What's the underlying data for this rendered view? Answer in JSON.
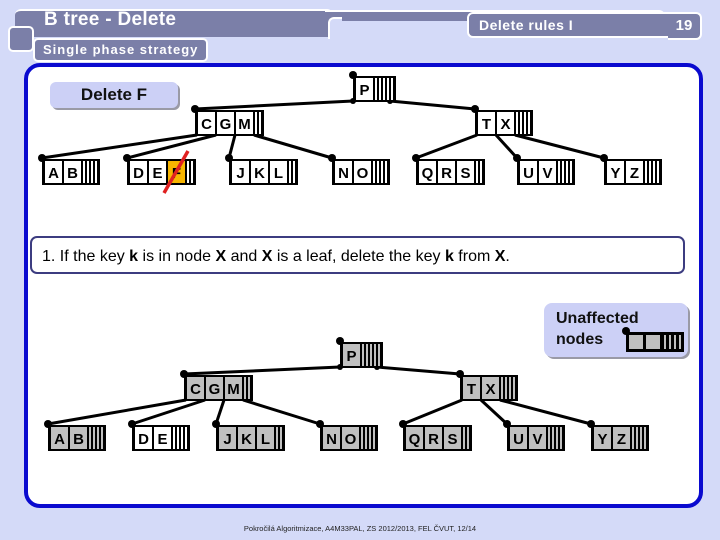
{
  "header": {
    "title": "B tree - Delete",
    "subtitle": "Single phase strategy",
    "section": "Delete rules I",
    "page_number": "19"
  },
  "operation_label": "Delete F",
  "rule": {
    "prefix": "1. If the key ",
    "k1": "k",
    "mid1": " is in node ",
    "x1": "X",
    "mid2": " and ",
    "x2": "X",
    "mid3": " is a leaf, delete the key ",
    "k2": "k",
    "mid4": " from ",
    "x3": "X",
    "suffix": "."
  },
  "legend": {
    "line1": "Unaffected",
    "line2": "nodes"
  },
  "colors": {
    "deleted_key_fill": "#f7b500",
    "strike": "#e02020",
    "unaffected_fill": "#c0c0c0",
    "affected_fill": "#ffffff",
    "panel_border": "#0a0acf"
  },
  "trees": {
    "before": {
      "root": {
        "keys": [
          "P"
        ]
      },
      "internal": [
        {
          "id": "cgm",
          "keys": [
            "C",
            "G",
            "M"
          ]
        },
        {
          "id": "tx",
          "keys": [
            "T",
            "X"
          ]
        }
      ],
      "leaves": [
        {
          "id": "ab",
          "parent": "cgm",
          "keys": [
            "A",
            "B"
          ]
        },
        {
          "id": "def",
          "parent": "cgm",
          "keys": [
            "D",
            "E",
            "F"
          ],
          "deleted_key": "F"
        },
        {
          "id": "jkl",
          "parent": "cgm",
          "keys": [
            "J",
            "K",
            "L"
          ]
        },
        {
          "id": "no",
          "parent": "cgm",
          "keys": [
            "N",
            "O"
          ]
        },
        {
          "id": "qrs",
          "parent": "tx",
          "keys": [
            "Q",
            "R",
            "S"
          ]
        },
        {
          "id": "uv",
          "parent": "tx",
          "keys": [
            "U",
            "V"
          ]
        },
        {
          "id": "yz",
          "parent": "tx",
          "keys": [
            "Y",
            "Z"
          ]
        }
      ]
    },
    "after": {
      "root": {
        "keys": [
          "P"
        ],
        "unaffected": true
      },
      "internal": [
        {
          "id": "cgm",
          "keys": [
            "C",
            "G",
            "M"
          ],
          "unaffected": true
        },
        {
          "id": "tx",
          "keys": [
            "T",
            "X"
          ],
          "unaffected": true
        }
      ],
      "leaves": [
        {
          "id": "ab",
          "parent": "cgm",
          "keys": [
            "A",
            "B"
          ],
          "unaffected": true
        },
        {
          "id": "de",
          "parent": "cgm",
          "keys": [
            "D",
            "E"
          ],
          "unaffected": false
        },
        {
          "id": "jkl",
          "parent": "cgm",
          "keys": [
            "J",
            "K",
            "L"
          ],
          "unaffected": true
        },
        {
          "id": "no",
          "parent": "cgm",
          "keys": [
            "N",
            "O"
          ],
          "unaffected": true
        },
        {
          "id": "qrs",
          "parent": "tx",
          "keys": [
            "Q",
            "R",
            "S"
          ],
          "unaffected": true
        },
        {
          "id": "uv",
          "parent": "tx",
          "keys": [
            "U",
            "V"
          ],
          "unaffected": true
        },
        {
          "id": "yz",
          "parent": "tx",
          "keys": [
            "Y",
            "Z"
          ],
          "unaffected": true
        }
      ]
    }
  },
  "footer": "Pokročilá Algoritmizace, A4M33PAL, ZS 2012/2013, FEL ČVUT,  12/14"
}
